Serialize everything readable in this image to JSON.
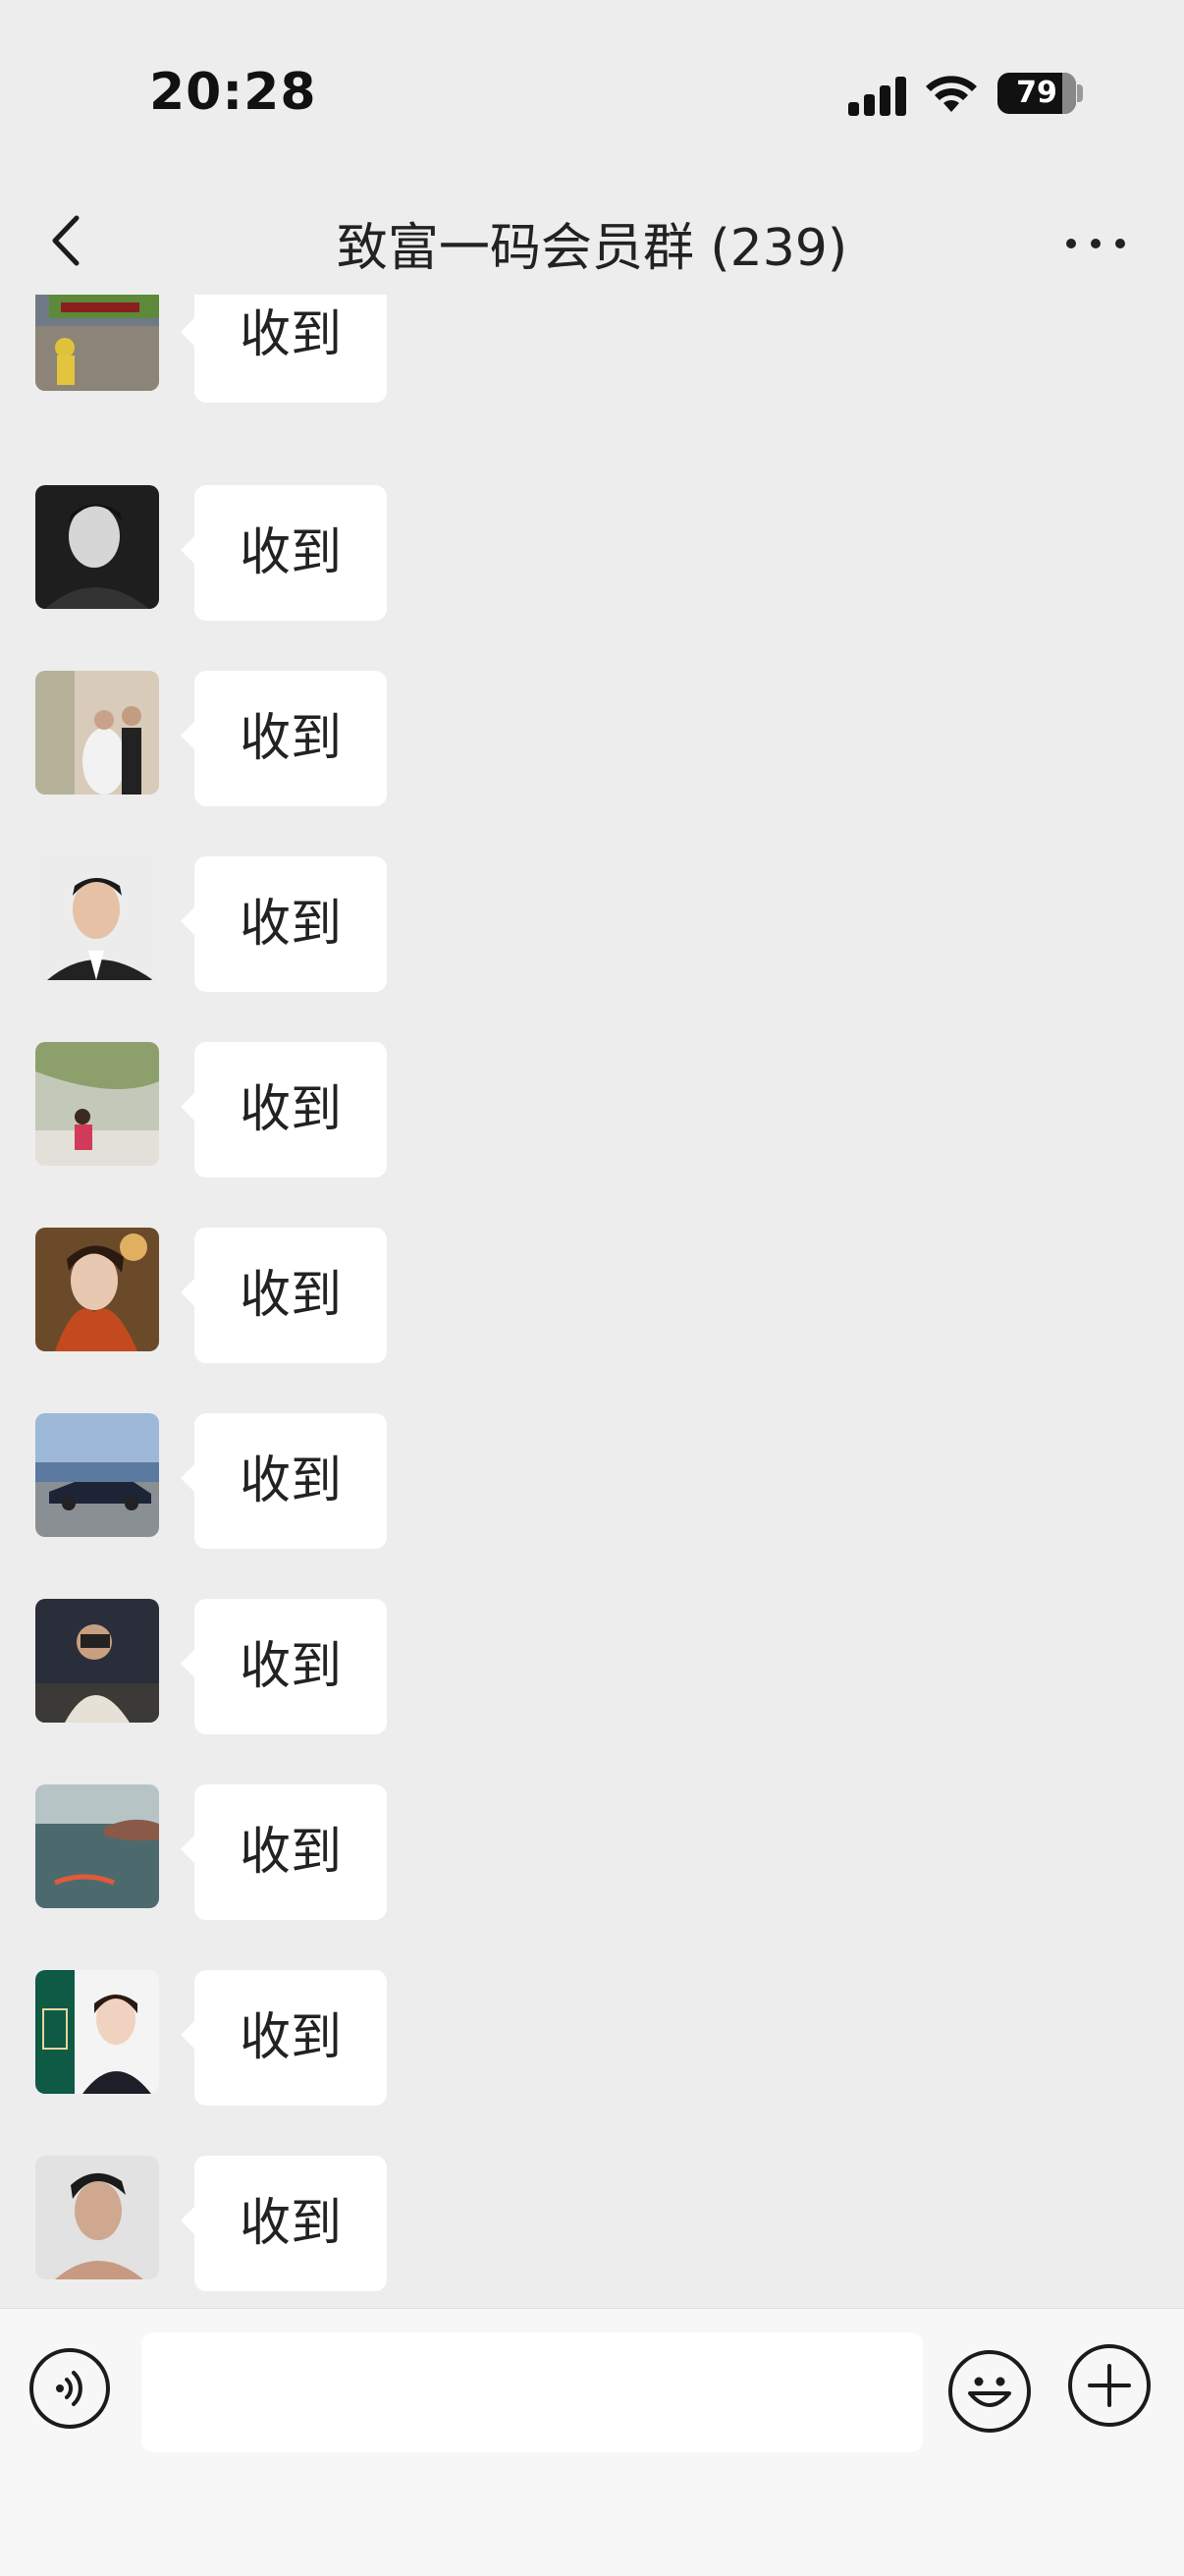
{
  "status_bar": {
    "time": "20:28",
    "battery": "79"
  },
  "header": {
    "title": "致富一码会员群 (239)"
  },
  "messages": [
    {
      "avatar_icon": "avatar-photo-car-child",
      "text": "收到"
    },
    {
      "avatar_icon": "avatar-photo-man-bw",
      "text": "收到"
    },
    {
      "avatar_icon": "avatar-photo-wedding",
      "text": "收到"
    },
    {
      "avatar_icon": "avatar-photo-man-suit",
      "text": "收到"
    },
    {
      "avatar_icon": "avatar-photo-woman-trees",
      "text": "收到"
    },
    {
      "avatar_icon": "avatar-photo-woman-scarf",
      "text": "收到"
    },
    {
      "avatar_icon": "avatar-photo-convertible-car",
      "text": "收到"
    },
    {
      "avatar_icon": "avatar-photo-man-camera",
      "text": "收到"
    },
    {
      "avatar_icon": "avatar-photo-sea-swimmer",
      "text": "收到"
    },
    {
      "avatar_icon": "avatar-photo-woman-business-card",
      "text": "收到"
    },
    {
      "avatar_icon": "avatar-photo-man-profile",
      "text": "收到"
    }
  ],
  "input_bar": {
    "value": "",
    "icons": [
      "voice-icon",
      "emoji-icon",
      "plus-icon"
    ]
  },
  "colors": {
    "background": "#ededed",
    "bubble": "#ffffff",
    "text": "#222222"
  }
}
